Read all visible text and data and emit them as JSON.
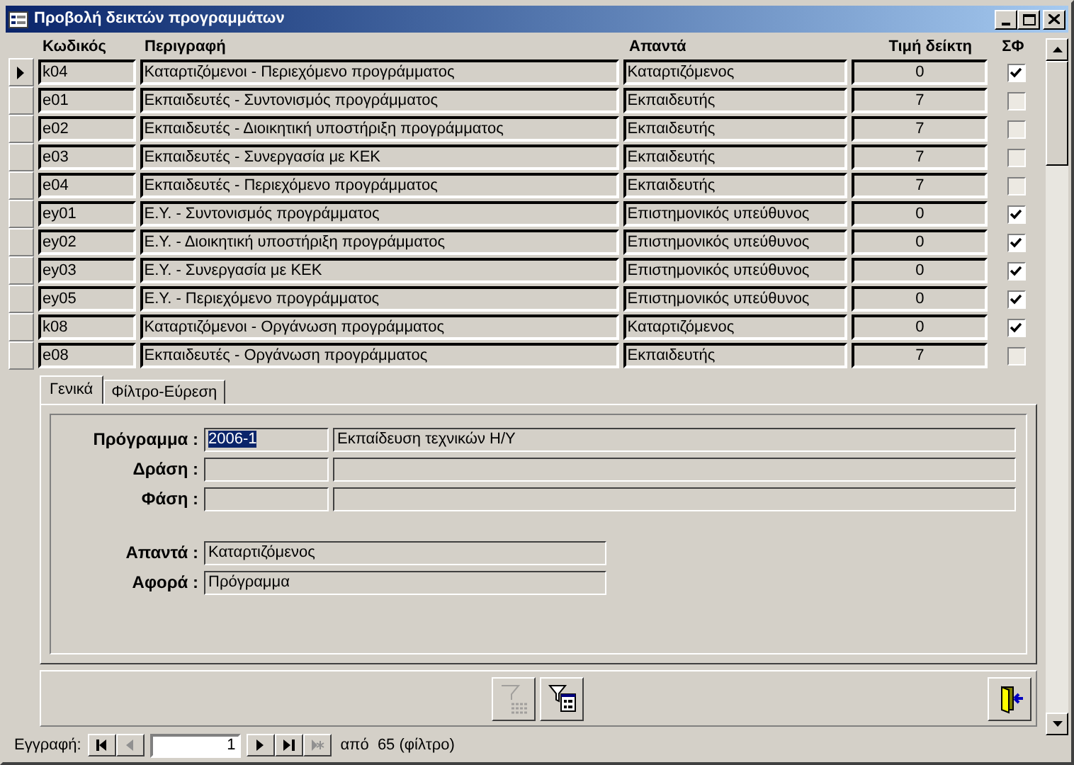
{
  "window": {
    "title": "Προβολή δεικτών προγραμμάτων"
  },
  "table": {
    "columns": [
      "Κωδικός",
      "Περιγραφή",
      "Απαντά",
      "Τιμή δείκτη",
      "ΣΦ"
    ],
    "rows": [
      {
        "selected": true,
        "code": "k04",
        "description": "Καταρτιζόμενοι - Περιεχόμενο προγράμματος",
        "answers": "Καταρτιζόμενος",
        "value": "0",
        "checked": true
      },
      {
        "selected": false,
        "code": "e01",
        "description": "Εκπαιδευτές - Συντονισμός προγράμματος",
        "answers": "Εκπαιδευτής",
        "value": "7",
        "checked": false
      },
      {
        "selected": false,
        "code": "e02",
        "description": "Εκπαιδευτές - Διοικητική υποστήριξη προγράμματος",
        "answers": "Εκπαιδευτής",
        "value": "7",
        "checked": false
      },
      {
        "selected": false,
        "code": "e03",
        "description": "Εκπαιδευτές - Συνεργασία με ΚΕΚ",
        "answers": "Εκπαιδευτής",
        "value": "7",
        "checked": false
      },
      {
        "selected": false,
        "code": "e04",
        "description": "Εκπαιδευτές - Περιεχόμενο προγράμματος",
        "answers": "Εκπαιδευτής",
        "value": "7",
        "checked": false
      },
      {
        "selected": false,
        "code": "ey01",
        "description": "Ε.Υ. - Συντονισμός προγράμματος",
        "answers": "Επιστημονικός υπεύθυνος",
        "value": "0",
        "checked": true
      },
      {
        "selected": false,
        "code": "ey02",
        "description": "Ε.Υ. - Διοικητική υποστήριξη προγράμματος",
        "answers": "Επιστημονικός υπεύθυνος",
        "value": "0",
        "checked": true
      },
      {
        "selected": false,
        "code": "ey03",
        "description": "Ε.Υ. - Συνεργασία με ΚΕΚ",
        "answers": "Επιστημονικός υπεύθυνος",
        "value": "0",
        "checked": true
      },
      {
        "selected": false,
        "code": "ey05",
        "description": "Ε.Υ. - Περιεχόμενο προγράμματος",
        "answers": "Επιστημονικός υπεύθυνος",
        "value": "0",
        "checked": true
      },
      {
        "selected": false,
        "code": "k08",
        "description": "Καταρτιζόμενοι - Οργάνωση προγράμματος",
        "answers": "Καταρτιζόμενος",
        "value": "0",
        "checked": true
      },
      {
        "selected": false,
        "code": "e08",
        "description": "Εκπαιδευτές - Οργάνωση προγράμματος",
        "answers": "Εκπαιδευτής",
        "value": "7",
        "checked": false
      }
    ]
  },
  "tabs": [
    {
      "label": "Γενικά",
      "selected": true
    },
    {
      "label": "Φίλτρο-Εύρεση",
      "selected": false
    }
  ],
  "details": {
    "program": {
      "label": "Πρόγραμμα :",
      "code": "2006-1",
      "name": "Εκπαίδευση τεχνικών Η/Υ"
    },
    "action": {
      "label": "Δράση :"
    },
    "phase": {
      "label": "Φάση :"
    },
    "answers": {
      "label": "Απαντά :",
      "value": "Καταρτιζόμενος"
    },
    "concerns": {
      "label": "Αφορά :",
      "value": "Πρόγραμμα"
    }
  },
  "buttons": [
    {
      "kind": "filter",
      "disabled": true
    },
    {
      "kind": "filter-form",
      "disabled": false
    },
    {
      "kind": "exit",
      "disabled": false
    }
  ],
  "navigation": {
    "label": "Εγγραφή:",
    "record": "1",
    "of": "από",
    "total": "65",
    "filter_note": "(φίλτρο)",
    "buttons": [
      {
        "kind": "first",
        "disabled": false
      },
      {
        "kind": "prev",
        "disabled": true
      },
      {
        "kind": "next",
        "disabled": false
      },
      {
        "kind": "last",
        "disabled": false
      },
      {
        "kind": "new",
        "disabled": true
      }
    ]
  }
}
